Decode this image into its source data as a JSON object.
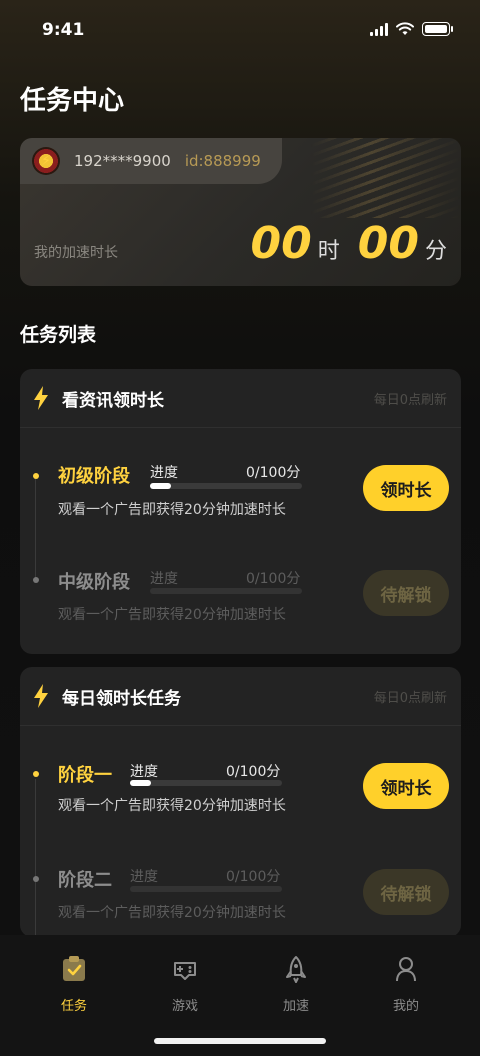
{
  "status_bar": {
    "time": "9:41"
  },
  "page_title": "任务中心",
  "account": {
    "phone": "192****9900",
    "id": "id:888999",
    "accel_label": "我的加速时长",
    "hours": "00",
    "hours_unit": "时",
    "minutes": "00",
    "minutes_unit": "分"
  },
  "section_title": "任务列表",
  "tasks": [
    {
      "title": "看资讯领时长",
      "refresh": "每日0点刷新",
      "stages": [
        {
          "name": "初级阶段",
          "progress_label": "进度",
          "progress_value": "0/100分",
          "progress": 0,
          "desc": "观看一个广告即获得20分钟加速时长",
          "button": "领时长",
          "state": "active"
        },
        {
          "name": "中级阶段",
          "progress_label": "进度",
          "progress_value": "0/100分",
          "progress": 0,
          "desc": "观看一个广告即获得20分钟加速时长",
          "button": "待解锁",
          "state": "locked"
        }
      ]
    },
    {
      "title": "每日领时长任务",
      "refresh": "每日0点刷新",
      "stages": [
        {
          "name": "阶段一",
          "progress_label": "进度",
          "progress_value": "0/100分",
          "progress": 0,
          "desc": "观看一个广告即获得20分钟加速时长",
          "button": "领时长",
          "state": "active"
        },
        {
          "name": "阶段二",
          "progress_label": "进度",
          "progress_value": "0/100分",
          "progress": 0,
          "desc": "观看一个广告即获得20分钟加速时长",
          "button": "待解锁",
          "state": "locked"
        }
      ]
    }
  ],
  "tab_bar": {
    "tabs": [
      {
        "label": "任务",
        "icon": "task-clipboard-icon",
        "selected": true
      },
      {
        "label": "游戏",
        "icon": "gamepad-icon",
        "selected": false
      },
      {
        "label": "加速",
        "icon": "rocket-icon",
        "selected": false
      },
      {
        "label": "我的",
        "icon": "user-icon",
        "selected": false
      }
    ]
  },
  "colors": {
    "accent": "#ffd23f",
    "background": "#111111",
    "card": "#232323"
  }
}
